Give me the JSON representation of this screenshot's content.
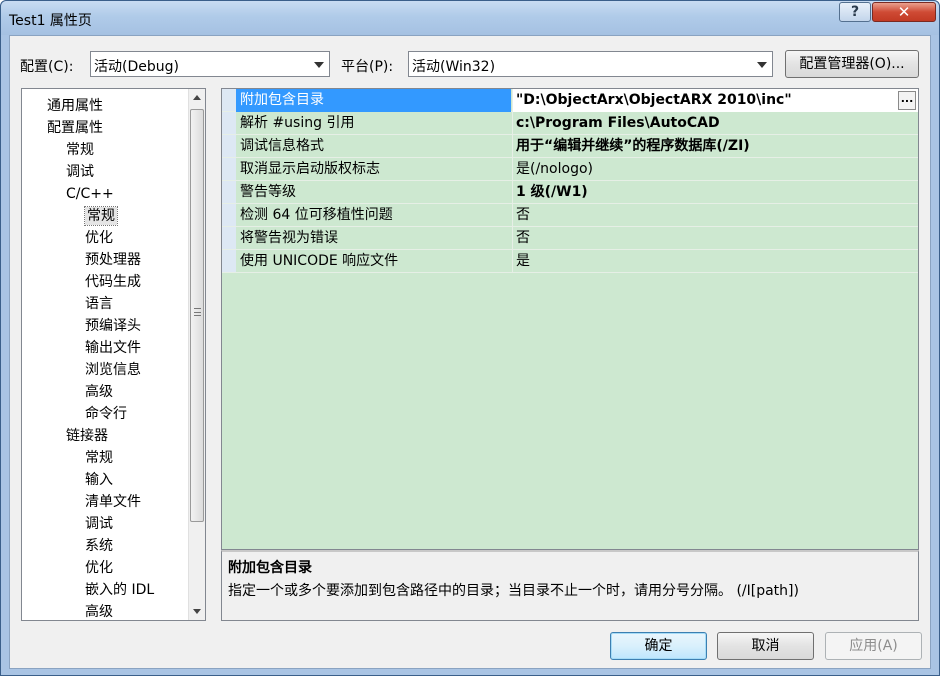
{
  "window": {
    "title": "Test1 属性页",
    "help_label": "?",
    "close_label": "✕"
  },
  "config": {
    "label": "配置(C):",
    "value": "活动(Debug)"
  },
  "platform": {
    "label": "平台(P):",
    "value": "活动(Win32)"
  },
  "config_manager_label": "配置管理器(O)...",
  "tree": {
    "items": [
      {
        "label": "通用属性",
        "level": 0
      },
      {
        "label": "配置属性",
        "level": 0
      },
      {
        "label": "常规",
        "level": 1
      },
      {
        "label": "调试",
        "level": 1
      },
      {
        "label": "C/C++",
        "level": 1
      },
      {
        "label": "常规",
        "level": 2,
        "selected": true
      },
      {
        "label": "优化",
        "level": 2
      },
      {
        "label": "预处理器",
        "level": 2
      },
      {
        "label": "代码生成",
        "level": 2
      },
      {
        "label": "语言",
        "level": 2
      },
      {
        "label": "预编译头",
        "level": 2
      },
      {
        "label": "输出文件",
        "level": 2
      },
      {
        "label": "浏览信息",
        "level": 2
      },
      {
        "label": "高级",
        "level": 2
      },
      {
        "label": "命令行",
        "level": 2
      },
      {
        "label": "链接器",
        "level": 1
      },
      {
        "label": "常规",
        "level": 2
      },
      {
        "label": "输入",
        "level": 2
      },
      {
        "label": "清单文件",
        "level": 2
      },
      {
        "label": "调试",
        "level": 2
      },
      {
        "label": "系统",
        "level": 2
      },
      {
        "label": "优化",
        "level": 2
      },
      {
        "label": "嵌入的 IDL",
        "level": 2
      },
      {
        "label": "高级",
        "level": 2
      }
    ]
  },
  "properties": [
    {
      "name": "附加包含目录",
      "value": "\"D:\\ObjectArx\\ObjectARX 2010\\inc\"",
      "bold": true,
      "selected": true
    },
    {
      "name": "解析 #using 引用",
      "value": "c:\\Program Files\\AutoCAD",
      "bold": true
    },
    {
      "name": "调试信息格式",
      "value": "用于“编辑并继续”的程序数据库(/ZI)",
      "bold": true
    },
    {
      "name": "取消显示启动版权标志",
      "value": "是(/nologo)",
      "bold": false
    },
    {
      "name": "警告等级",
      "value": "1 级(/W1)",
      "bold": true
    },
    {
      "name": "检测 64 位可移植性问题",
      "value": "否",
      "bold": false
    },
    {
      "name": "将警告视为错误",
      "value": "否",
      "bold": false
    },
    {
      "name": "使用 UNICODE 响应文件",
      "value": "是",
      "bold": false
    }
  ],
  "ellipsis_label": "...",
  "description": {
    "title": "附加包含目录",
    "text": "指定一个或多个要添加到包含路径中的目录；当目录不止一个时，请用分号分隔。     (/I[path])"
  },
  "buttons": {
    "ok": "确定",
    "cancel": "取消",
    "apply": "应用(A)"
  }
}
